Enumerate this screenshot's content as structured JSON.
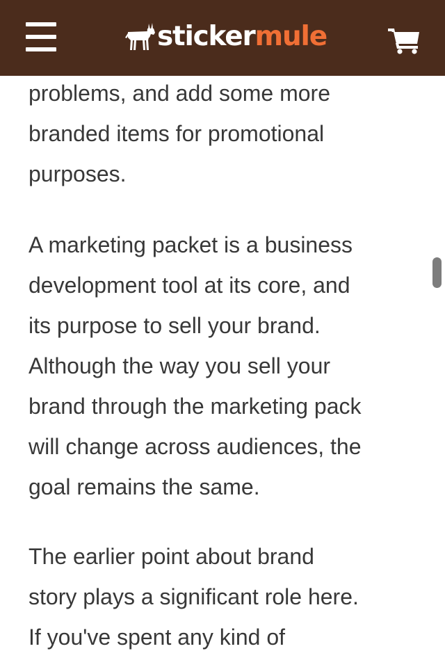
{
  "header": {
    "logo": {
      "part1": "sticker",
      "part2": "mule"
    },
    "menu_icon": "hamburger-menu-icon",
    "cart_icon": "shopping-cart-icon"
  },
  "colors": {
    "header_bg": "#4b2c1c",
    "brand_orange": "#f06f35",
    "text": "#383838"
  },
  "article": {
    "paragraphs": [
      {
        "lines": [
          "problems, and add some more",
          "branded items for promotional",
          "purposes."
        ]
      },
      {
        "lines": [
          "A marketing packet is a business",
          "development tool at its core, and",
          "its purpose to sell your brand.",
          "Although the way you sell your",
          "brand through the marketing pack",
          "will change across audiences, the",
          "goal remains the same."
        ]
      },
      {
        "lines": [
          "The earlier point about brand",
          "story plays a significant role here.",
          "If you've spent any kind of"
        ]
      }
    ]
  }
}
